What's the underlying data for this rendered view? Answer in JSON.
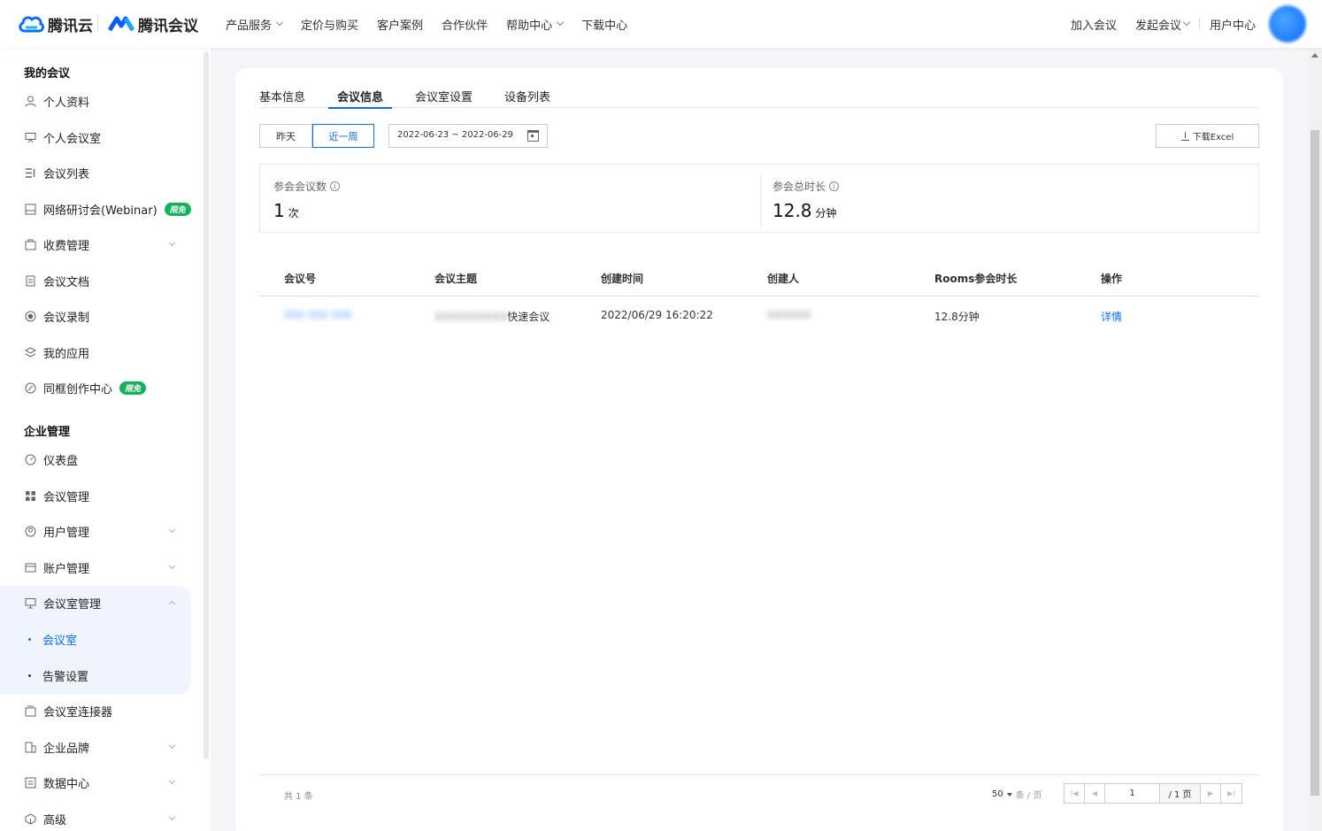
{
  "header": {
    "brand1": "腾讯云",
    "brand2": "腾讯会议",
    "nav": [
      {
        "label": "产品服务",
        "dropdown": true
      },
      {
        "label": "定价与购买",
        "dropdown": false
      },
      {
        "label": "客户案例",
        "dropdown": false
      },
      {
        "label": "合作伙伴",
        "dropdown": false
      },
      {
        "label": "帮助中心",
        "dropdown": true
      },
      {
        "label": "下载中心",
        "dropdown": false
      }
    ],
    "right": {
      "join": "加入会议",
      "start": "发起会议",
      "user_center": "用户中心"
    }
  },
  "sidebar": {
    "my_meetings_title": "我的会议",
    "my_meetings": [
      {
        "label": "个人资料",
        "icon": "user-icon"
      },
      {
        "label": "个人会议室",
        "icon": "meeting-room-icon"
      },
      {
        "label": "会议列表",
        "icon": "list-icon"
      },
      {
        "label": "网络研讨会(Webinar)",
        "icon": "webinar-icon",
        "badge": "限免"
      },
      {
        "label": "收费管理",
        "icon": "fee-icon",
        "expandable": true
      },
      {
        "label": "会议文档",
        "icon": "document-icon"
      },
      {
        "label": "会议录制",
        "icon": "record-icon"
      },
      {
        "label": "我的应用",
        "icon": "apps-icon"
      },
      {
        "label": "同框创作中心",
        "icon": "creation-icon",
        "badge": "限免"
      }
    ],
    "enterprise_title": "企业管理",
    "enterprise": [
      {
        "label": "仪表盘",
        "icon": "dashboard-icon"
      },
      {
        "label": "会议管理",
        "icon": "grid-icon"
      },
      {
        "label": "用户管理",
        "icon": "users-icon",
        "expandable": true
      },
      {
        "label": "账户管理",
        "icon": "account-icon",
        "expandable": true
      },
      {
        "label": "会议室管理",
        "icon": "room-manage-icon",
        "expanded": true
      }
    ],
    "room_sub": [
      {
        "label": "会议室",
        "active": true
      },
      {
        "label": "告警设置",
        "active": false
      }
    ],
    "enterprise_rest": [
      {
        "label": "会议室连接器",
        "icon": "connector-icon"
      },
      {
        "label": "企业品牌",
        "icon": "brand-icon",
        "expandable": true
      },
      {
        "label": "数据中心",
        "icon": "data-icon",
        "expandable": true
      },
      {
        "label": "高级",
        "icon": "advanced-icon",
        "expandable": true
      }
    ]
  },
  "tabs": [
    {
      "label": "基本信息",
      "active": false
    },
    {
      "label": "会议信息",
      "active": true
    },
    {
      "label": "会议室设置",
      "active": false
    },
    {
      "label": "设备列表",
      "active": false
    }
  ],
  "filters": {
    "yesterday": "昨天",
    "last_week": "近一周",
    "date_range": "2022-06-23 ~ 2022-06-29",
    "download": "下载Excel"
  },
  "stats": {
    "count_label": "参会会议数",
    "count_value": "1",
    "count_unit": "次",
    "duration_label": "参会总时长",
    "duration_value": "12.8",
    "duration_unit": "分钟"
  },
  "table": {
    "columns": [
      "会议号",
      "会议主题",
      "创建时间",
      "创建人",
      "Rooms参会时长",
      "操作"
    ],
    "rows": [
      {
        "meeting_id": "000 000 000",
        "topic_blur": "XXXXXXXXXX",
        "topic": "快速会议",
        "created": "2022/06/29 16:20:22",
        "creator": "XXXXXX",
        "duration": "12.8分钟",
        "action": "详情"
      }
    ]
  },
  "pager": {
    "total": "共 1 条",
    "page_size": "50",
    "per_page": "条 / 页",
    "current": "1",
    "total_pages": "/ 1 页"
  },
  "colors": {
    "accent": "#0a6cff",
    "badge": "#13b35e"
  }
}
